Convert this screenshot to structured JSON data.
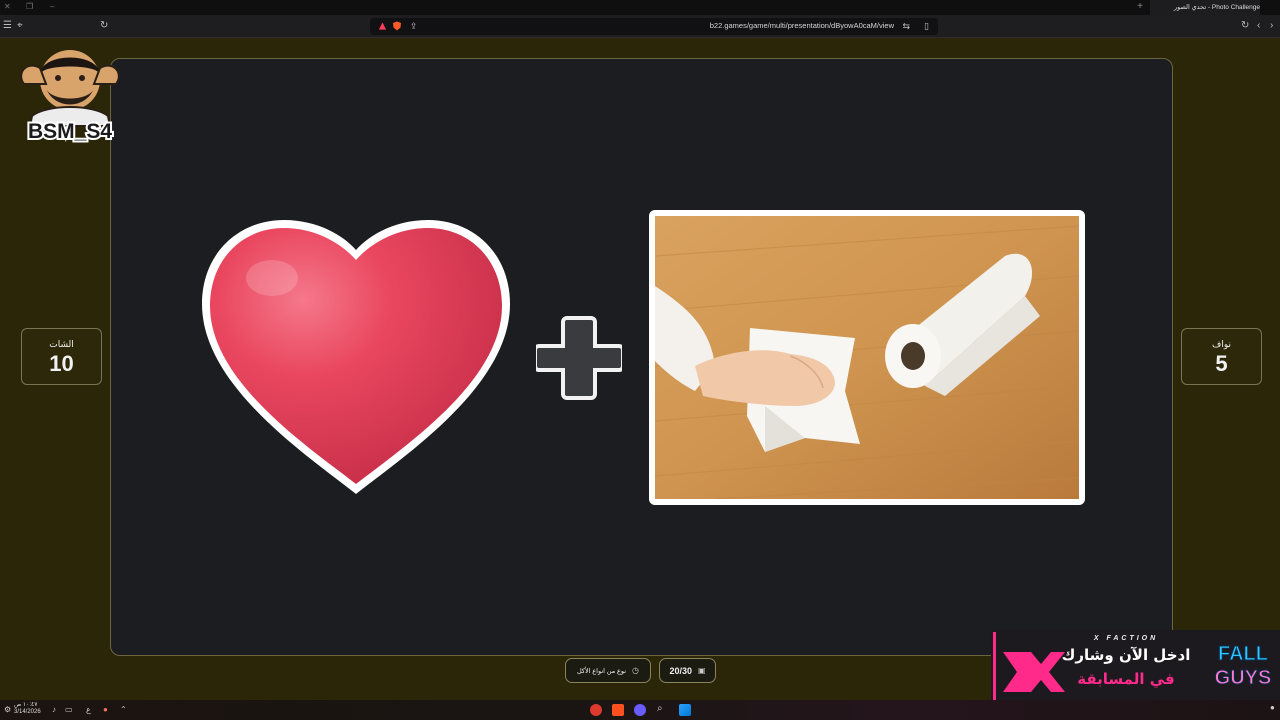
{
  "browser": {
    "tab_title": "Photo Challenge - تحدي الصور",
    "url": "b22.games/game/multi/presentation/dByowA0caM/view",
    "new_tab": "+",
    "tab_close": "×"
  },
  "game": {
    "teams": [
      {
        "name": "الشات",
        "score": "10"
      },
      {
        "name": "نواف",
        "score": "5"
      }
    ],
    "hint_label": "نوع من انواع الأكل",
    "question_counter": "20/30",
    "puzzle_items": [
      "heart-emoji",
      "paper-towel-photo"
    ],
    "operator": "plus"
  },
  "overlays": {
    "streamer_name": "BSM_S4",
    "promo_brand": "X FACTION",
    "promo_text_line1": "ادخل الآن وشارك",
    "promo_text_line2": "في المسابقة",
    "promo_game_line1": "FALL",
    "promo_game_line2": "GUYS"
  },
  "taskbar": {
    "time": "١٠:٤٧ ص",
    "date": "3/14/2026",
    "lang": "ع"
  },
  "colors": {
    "page_bg": "#2b2607",
    "board_bg": "#1c1d20",
    "card_border": "#7a7450",
    "heart_red": "#e03a55",
    "promo_pink": "#ff2a8a"
  }
}
